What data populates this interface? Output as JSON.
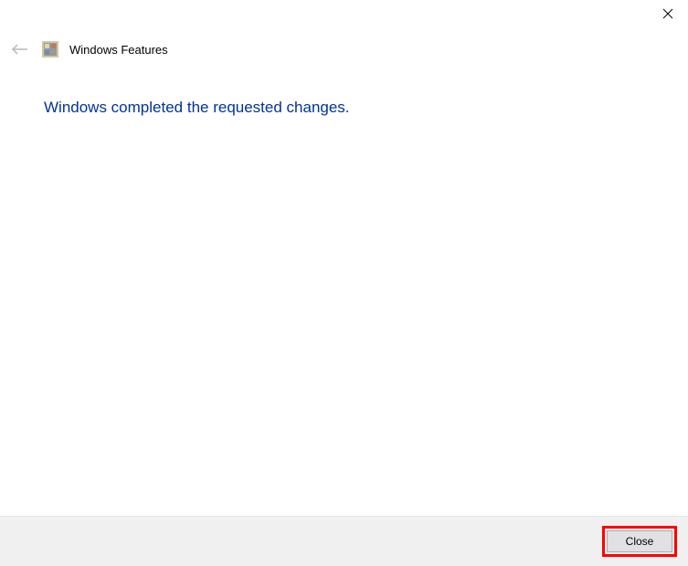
{
  "header": {
    "title": "Windows Features"
  },
  "main": {
    "message": "Windows completed the requested changes."
  },
  "footer": {
    "close_label": "Close"
  }
}
